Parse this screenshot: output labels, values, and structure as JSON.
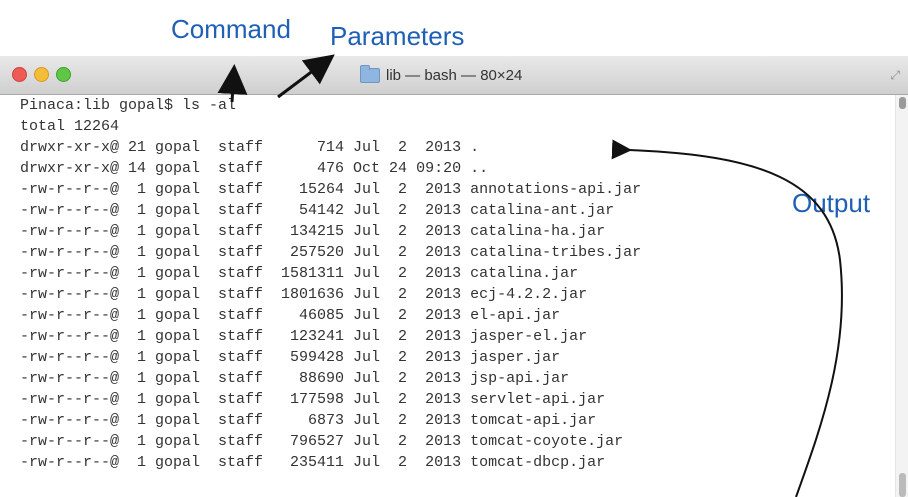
{
  "annotations": {
    "command": "Command",
    "parameters": "Parameters",
    "output": "Output"
  },
  "window": {
    "title": "lib — bash — 80×24",
    "folder_icon": "folder-icon",
    "traffic_lights": {
      "close": "#ee5b55",
      "minimize": "#f5bc3a",
      "maximize": "#5fc746"
    }
  },
  "terminal": {
    "lines": [
      "Pinaca:lib gopal$ ls -al",
      "total 12264",
      "drwxr-xr-x@ 21 gopal  staff      714 Jul  2  2013 .",
      "drwxr-xr-x@ 14 gopal  staff      476 Oct 24 09:20 ..",
      "-rw-r--r--@  1 gopal  staff    15264 Jul  2  2013 annotations-api.jar",
      "-rw-r--r--@  1 gopal  staff    54142 Jul  2  2013 catalina-ant.jar",
      "-rw-r--r--@  1 gopal  staff   134215 Jul  2  2013 catalina-ha.jar",
      "-rw-r--r--@  1 gopal  staff   257520 Jul  2  2013 catalina-tribes.jar",
      "-rw-r--r--@  1 gopal  staff  1581311 Jul  2  2013 catalina.jar",
      "-rw-r--r--@  1 gopal  staff  1801636 Jul  2  2013 ecj-4.2.2.jar",
      "-rw-r--r--@  1 gopal  staff    46085 Jul  2  2013 el-api.jar",
      "-rw-r--r--@  1 gopal  staff   123241 Jul  2  2013 jasper-el.jar",
      "-rw-r--r--@  1 gopal  staff   599428 Jul  2  2013 jasper.jar",
      "-rw-r--r--@  1 gopal  staff    88690 Jul  2  2013 jsp-api.jar",
      "-rw-r--r--@  1 gopal  staff   177598 Jul  2  2013 servlet-api.jar",
      "-rw-r--r--@  1 gopal  staff     6873 Jul  2  2013 tomcat-api.jar",
      "-rw-r--r--@  1 gopal  staff   796527 Jul  2  2013 tomcat-coyote.jar",
      "-rw-r--r--@  1 gopal  staff   235411 Jul  2  2013 tomcat-dbcp.jar"
    ]
  }
}
